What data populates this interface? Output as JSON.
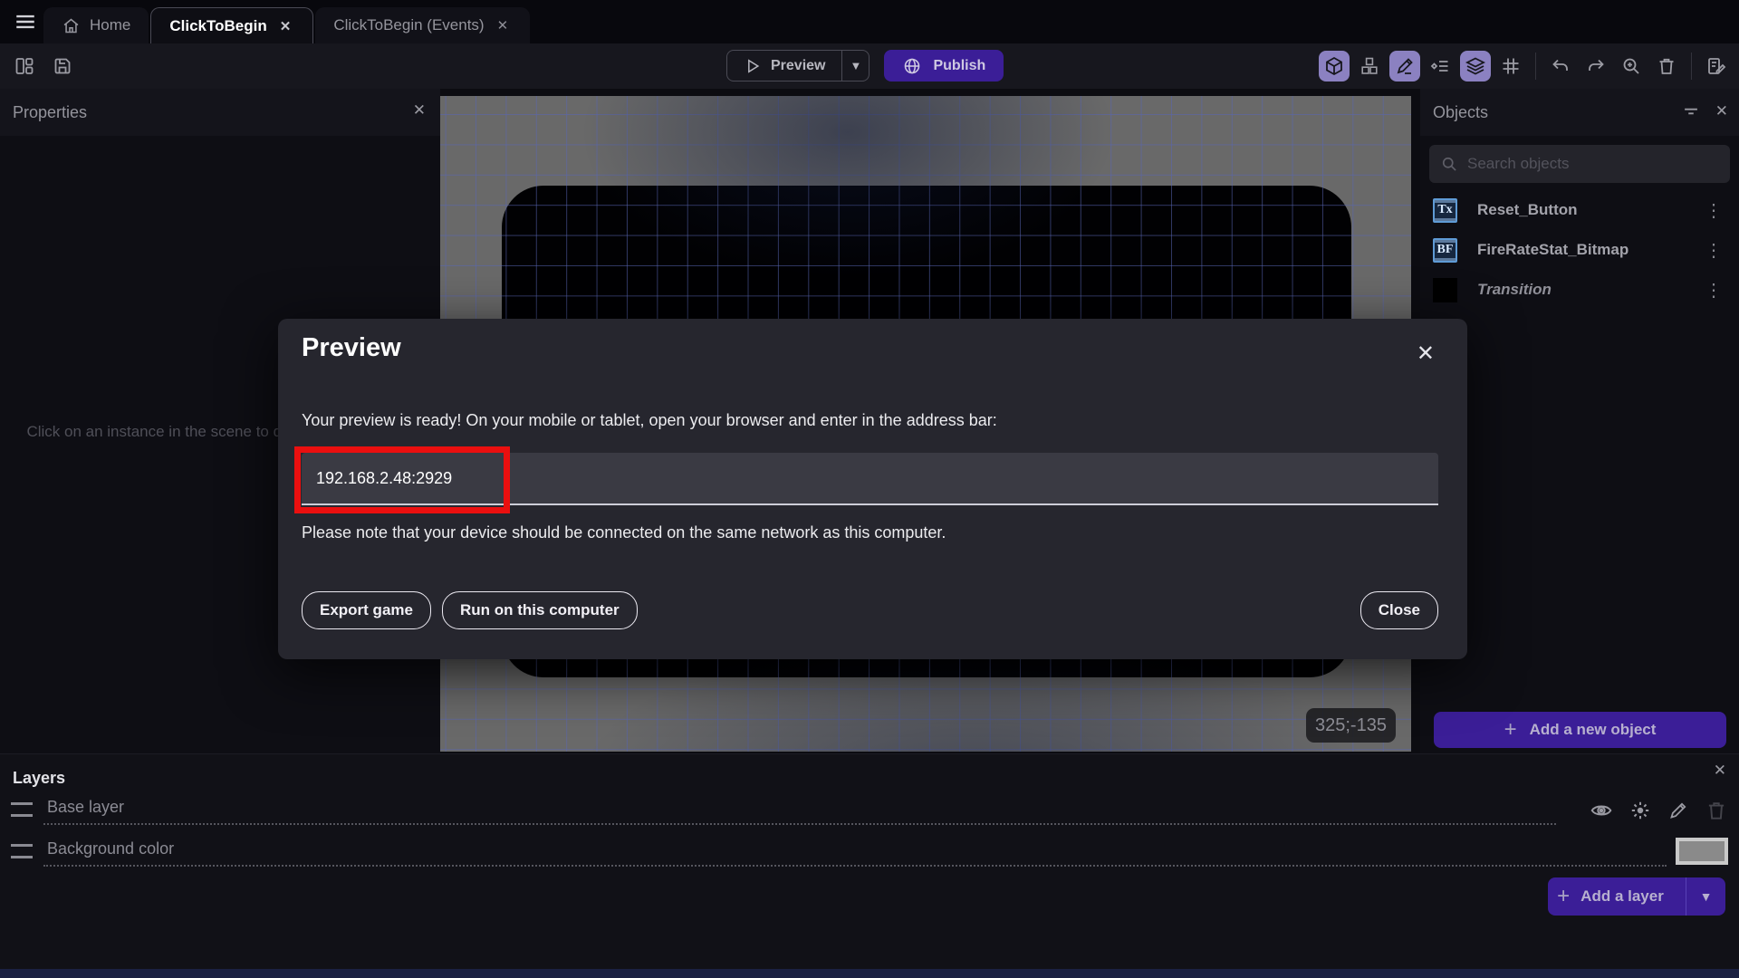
{
  "ui": {
    "close_glyph": "✕",
    "dots_glyph": "⋮",
    "caret_down_glyph": "▼",
    "plus_glyph": "+"
  },
  "tab_bar": {
    "tabs": [
      {
        "label": "Home",
        "icon": "home-icon",
        "active": false
      },
      {
        "label": "ClickToBegin",
        "active": true
      },
      {
        "label": "ClickToBegin (Events)",
        "active": false
      }
    ]
  },
  "toolbar": {
    "preview_label": "Preview",
    "publish_label": "Publish",
    "left_icons": [
      "panels-icon",
      "save-icon"
    ],
    "right_icons": [
      "cube-3d-icon",
      "instances-icon",
      "edit-scene-icon",
      "instances-list-icon",
      "layers-icon",
      "grid-icon",
      "undo-icon",
      "redo-icon",
      "zoom-in-icon",
      "delete-icon",
      "scene-properties-icon"
    ]
  },
  "properties_panel": {
    "title": "Properties",
    "empty_message": "Click on an instance in the scene to display its properties"
  },
  "scene_canvas": {
    "coordinates_badge": "325;-135"
  },
  "objects_panel": {
    "title": "Objects",
    "search_placeholder": "Search objects",
    "items": [
      {
        "label": "Reset_Button",
        "icon_text": "Tx",
        "icon": "text-object-icon"
      },
      {
        "label": "FireRateStat_Bitmap",
        "icon_text": "BF",
        "icon": "bitmap-font-object-icon"
      },
      {
        "label": "Transition",
        "icon_text": "",
        "icon": "black-square-object-icon"
      }
    ],
    "add_button_label": "Add a new object"
  },
  "layers_panel": {
    "title": "Layers",
    "rows": [
      {
        "label": "Base layer"
      },
      {
        "label": "Background color"
      }
    ],
    "add_button_label": "Add a layer"
  },
  "preview_dialog": {
    "title": "Preview",
    "message": "Your preview is ready! On your mobile or tablet, open your browser and enter in the address bar:",
    "address": "192.168.2.48:2929",
    "note": "Please note that your device should be connected on the same network as this computer.",
    "export_button": "Export game",
    "run_button": "Run on this computer",
    "close_button": "Close"
  },
  "colors": {
    "accent_purple": "#3b1e97",
    "selected_toggle_purple": "#8b81c1",
    "annotation_red": "#ea0f0f",
    "canvas_gray": "#696969",
    "grid_blue": "#5866b4"
  }
}
